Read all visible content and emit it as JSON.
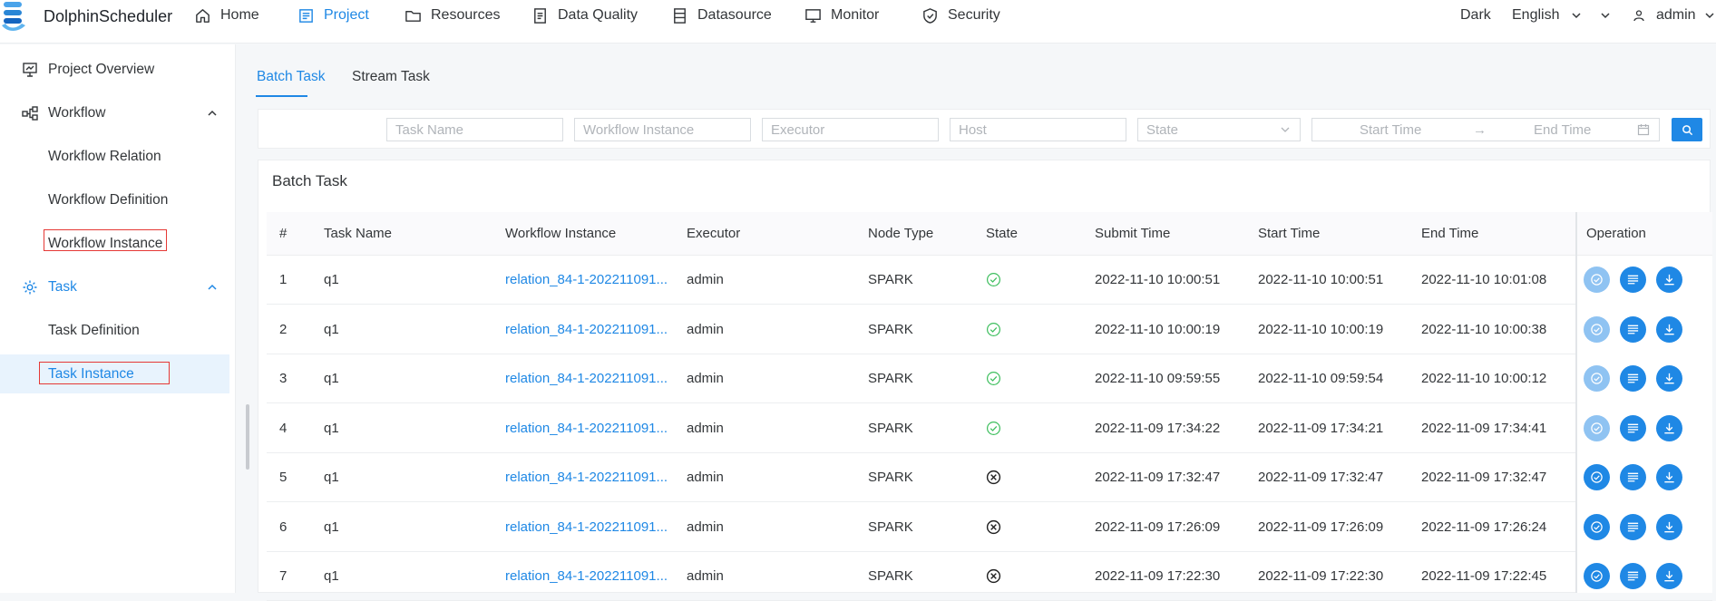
{
  "header": {
    "brand": "DolphinScheduler",
    "nav": [
      {
        "label": "Home",
        "icon": "home-icon"
      },
      {
        "label": "Project",
        "icon": "project-icon",
        "active": true
      },
      {
        "label": "Resources",
        "icon": "folder-icon"
      },
      {
        "label": "Data Quality",
        "icon": "data-quality-icon"
      },
      {
        "label": "Datasource",
        "icon": "datasource-icon"
      },
      {
        "label": "Monitor",
        "icon": "monitor-icon"
      },
      {
        "label": "Security",
        "icon": "shield-icon"
      }
    ],
    "theme": "Dark",
    "language": "English",
    "user": "admin"
  },
  "sidebar": {
    "items": [
      {
        "label": "Project Overview",
        "icon": "project-overview-icon"
      },
      {
        "label": "Workflow",
        "icon": "workflow-icon",
        "expanded": true
      },
      {
        "label": "Workflow Relation"
      },
      {
        "label": "Workflow Definition"
      },
      {
        "label": "Workflow Instance",
        "highlighted": true
      },
      {
        "label": "Task",
        "icon": "gear-icon",
        "expanded": true
      },
      {
        "label": "Task Definition"
      },
      {
        "label": "Task Instance",
        "active": true,
        "highlighted": true
      }
    ]
  },
  "tabs": [
    {
      "label": "Batch Task",
      "active": true
    },
    {
      "label": "Stream Task"
    }
  ],
  "filters": {
    "task_name": "Task Name",
    "workflow_instance": "Workflow Instance",
    "executor": "Executor",
    "host": "Host",
    "state": "State",
    "start_time": "Start Time",
    "end_time": "End Time"
  },
  "card_title": "Batch Task",
  "table": {
    "columns": [
      "#",
      "Task Name",
      "Workflow Instance",
      "Executor",
      "Node Type",
      "State",
      "Submit Time",
      "Start Time",
      "End Time",
      "Operation"
    ],
    "rows": [
      {
        "no": "1",
        "task": "q1",
        "workflow": "relation_84-1-202211091...",
        "executor": "admin",
        "node": "SPARK",
        "state": "success",
        "submit": "2022-11-10 10:00:51",
        "start": "2022-11-10 10:00:51",
        "end": "2022-11-10 10:01:08"
      },
      {
        "no": "2",
        "task": "q1",
        "workflow": "relation_84-1-202211091...",
        "executor": "admin",
        "node": "SPARK",
        "state": "success",
        "submit": "2022-11-10 10:00:19",
        "start": "2022-11-10 10:00:19",
        "end": "2022-11-10 10:00:38"
      },
      {
        "no": "3",
        "task": "q1",
        "workflow": "relation_84-1-202211091...",
        "executor": "admin",
        "node": "SPARK",
        "state": "success",
        "submit": "2022-11-10 09:59:55",
        "start": "2022-11-10 09:59:54",
        "end": "2022-11-10 10:00:12"
      },
      {
        "no": "4",
        "task": "q1",
        "workflow": "relation_84-1-202211091...",
        "executor": "admin",
        "node": "SPARK",
        "state": "success",
        "submit": "2022-11-09 17:34:22",
        "start": "2022-11-09 17:34:21",
        "end": "2022-11-09 17:34:41"
      },
      {
        "no": "5",
        "task": "q1",
        "workflow": "relation_84-1-202211091...",
        "executor": "admin",
        "node": "SPARK",
        "state": "failure",
        "submit": "2022-11-09 17:32:47",
        "start": "2022-11-09 17:32:47",
        "end": "2022-11-09 17:32:47"
      },
      {
        "no": "6",
        "task": "q1",
        "workflow": "relation_84-1-202211091...",
        "executor": "admin",
        "node": "SPARK",
        "state": "failure",
        "submit": "2022-11-09 17:26:09",
        "start": "2022-11-09 17:26:09",
        "end": "2022-11-09 17:26:24"
      },
      {
        "no": "7",
        "task": "q1",
        "workflow": "relation_84-1-202211091...",
        "executor": "admin",
        "node": "SPARK",
        "state": "failure",
        "submit": "2022-11-09 17:22:30",
        "start": "2022-11-09 17:22:30",
        "end": "2022-11-09 17:22:45"
      }
    ]
  },
  "colors": {
    "accent": "#1f88e5",
    "success": "#3fbf5f",
    "failure": "#222222",
    "highlight_box": "#e53935"
  }
}
